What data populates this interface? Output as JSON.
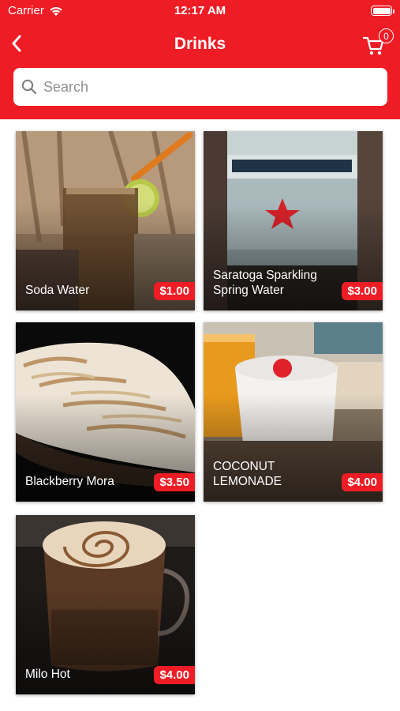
{
  "status_bar": {
    "carrier": "Carrier",
    "time": "12:17 AM"
  },
  "nav": {
    "title": "Drinks",
    "back_icon": "chevron-left-icon",
    "cart_icon": "cart-icon",
    "cart_count": "0"
  },
  "search": {
    "placeholder": "Search",
    "value": ""
  },
  "colors": {
    "accent": "#ee1c25",
    "header_text": "#ffffff"
  },
  "products": [
    {
      "name": "Soda Water",
      "price": "$1.00"
    },
    {
      "name": "Saratoga Sparkling Spring Water",
      "price": "$3.00"
    },
    {
      "name": "Blackberry Mora",
      "price": "$3.50"
    },
    {
      "name": "COCONUT LEMONADE",
      "price": "$4.00"
    },
    {
      "name": "Milo Hot",
      "price": "$4.00"
    }
  ]
}
